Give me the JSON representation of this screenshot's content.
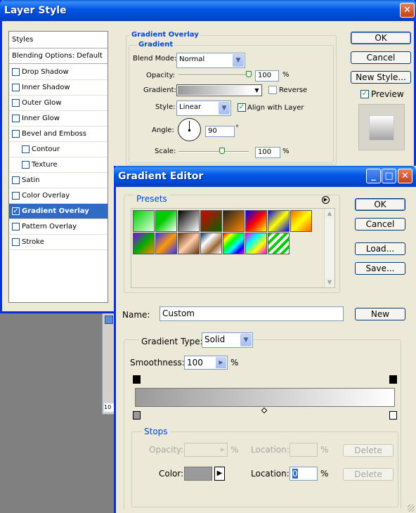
{
  "layer_style": {
    "title": "Layer Style",
    "styles_header": "Styles",
    "blending_options": "Blending Options: Default",
    "items": [
      {
        "label": "Drop Shadow",
        "checked": false
      },
      {
        "label": "Inner Shadow",
        "checked": false
      },
      {
        "label": "Outer Glow",
        "checked": false
      },
      {
        "label": "Inner Glow",
        "checked": false
      },
      {
        "label": "Bevel and Emboss",
        "checked": false
      },
      {
        "label": "Contour",
        "checked": false
      },
      {
        "label": "Texture",
        "checked": false
      },
      {
        "label": "Satin",
        "checked": false
      },
      {
        "label": "Color Overlay",
        "checked": false
      },
      {
        "label": "Gradient Overlay",
        "checked": true
      },
      {
        "label": "Pattern Overlay",
        "checked": false
      },
      {
        "label": "Stroke",
        "checked": false
      }
    ],
    "section_title": "Gradient Overlay",
    "group_title": "Gradient",
    "blend_mode_label": "Blend Mode:",
    "blend_mode_value": "Normal",
    "opacity_label": "Opacity:",
    "opacity_value": "100",
    "percent": "%",
    "gradient_label": "Gradient:",
    "reverse_label": "Reverse",
    "style_label": "Style:",
    "style_value": "Linear",
    "align_label": "Align with Layer",
    "angle_label": "Angle:",
    "angle_value": "90",
    "degree": "°",
    "scale_label": "Scale:",
    "scale_value": "100",
    "ok": "OK",
    "cancel": "Cancel",
    "new_style": "New Style...",
    "preview": "Preview"
  },
  "gradient_editor": {
    "title": "Gradient Editor",
    "presets_label": "Presets",
    "ok": "OK",
    "cancel": "Cancel",
    "load": "Load...",
    "save": "Save...",
    "name_label": "Name:",
    "name_value": "Custom",
    "new_button": "New",
    "gradient_type_label": "Gradient Type:",
    "gradient_type_value": "Solid",
    "smoothness_label": "Smoothness:",
    "smoothness_value": "100",
    "percent": "%",
    "stops_label": "Stops",
    "opacity_label": "Opacity:",
    "location_label": "Location:",
    "delete": "Delete",
    "color_label": "Color:",
    "location_value": "0",
    "stop_color": "#9a9a9a"
  },
  "background_fragment": "10"
}
